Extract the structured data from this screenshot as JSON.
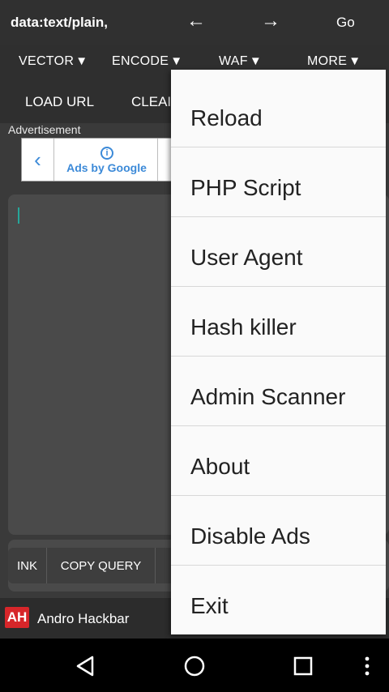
{
  "topbar": {
    "url": "data:text/plain,",
    "back": "←",
    "forward": "→",
    "go": "Go"
  },
  "menubar": {
    "tabs": [
      {
        "label": "VECTOR",
        "tri": "▼"
      },
      {
        "label": "ENCODE",
        "tri": "▼"
      },
      {
        "label": "WAF",
        "tri": "▼"
      },
      {
        "label": "MORE",
        "tri": "▼"
      }
    ]
  },
  "actionbar": {
    "load_url": "LOAD URL",
    "clear": "CLEAI"
  },
  "ad": {
    "label": "Advertisement",
    "chevron": "‹",
    "info_icon": "i",
    "text": "Ads by Google"
  },
  "bottom_buttons": {
    "link": "INK",
    "copy_query": "COPY QUERY"
  },
  "app": {
    "logo": "AH",
    "name": "Andro Hackbar"
  },
  "dropdown": {
    "items": [
      "Reload",
      "PHP Script",
      "User Agent",
      "Hash killer",
      "Admin Scanner",
      "About",
      "Disable Ads",
      "Exit"
    ]
  },
  "navbar": {
    "icons": [
      "back-triangle-icon",
      "home-circle-icon",
      "recents-square-icon",
      "overflow-dots-icon"
    ]
  }
}
